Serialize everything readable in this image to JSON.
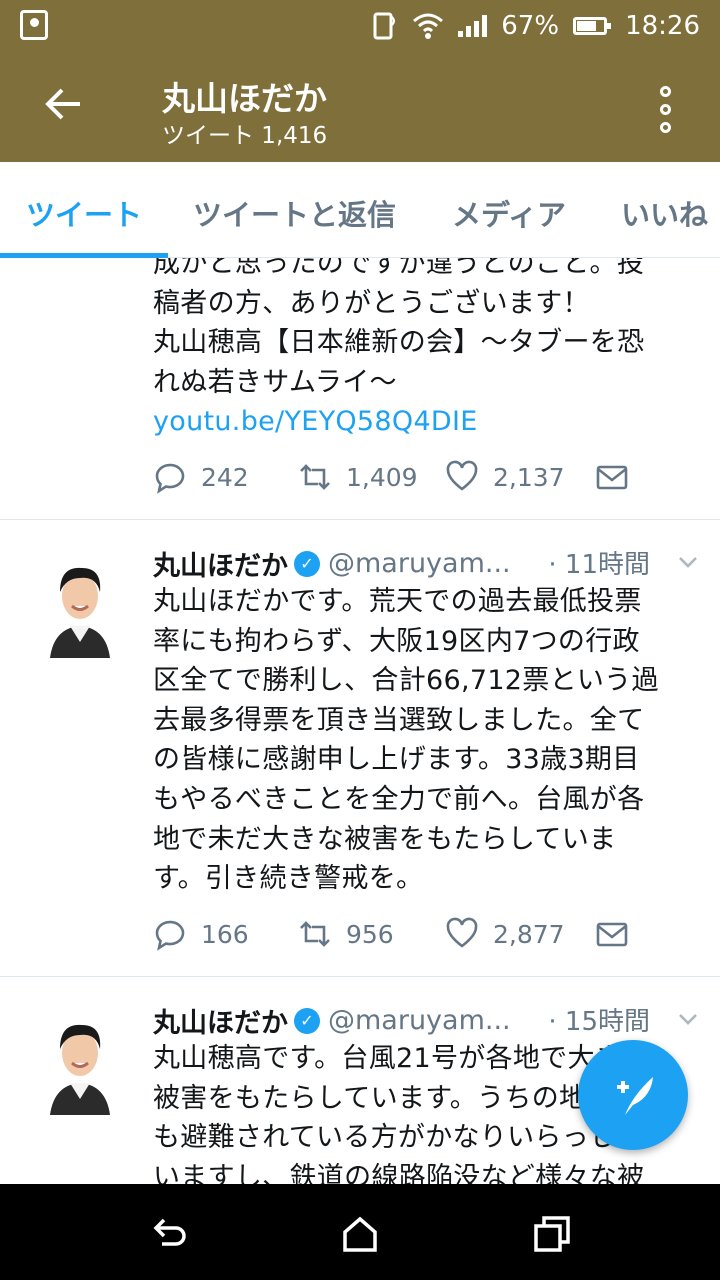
{
  "status_bar": {
    "battery": "67%",
    "time": "18:26",
    "battery_level": 0.67
  },
  "header": {
    "back_icon": "arrow-left-icon",
    "title": "丸山ほだか",
    "subtitle": "ツイート 1,416",
    "more_icon": "more-vertical-icon"
  },
  "tabs": [
    {
      "label": "ツイート",
      "active": true
    },
    {
      "label": "ツイートと返信",
      "active": false
    },
    {
      "label": "メディア",
      "active": false
    },
    {
      "label": "いいね",
      "active": false
    }
  ],
  "tweets": [
    {
      "lines": [
        "成かと思ったのですが違うとのこと。投",
        "稿者の方、ありがとうございます！",
        "丸山穂高【日本維新の会】～タブーを恐",
        "れぬ若きサムライ～"
      ],
      "link": "youtu.be/YEYQ58Q4DIE",
      "replies": "242",
      "retweets": "1,409",
      "likes": "2,137"
    },
    {
      "name": "丸山ほだか",
      "handle": "@maruyam...",
      "time": "· 11時間",
      "lines": [
        "丸山ほだかです。荒天での過去最低投票",
        "率にも拘わらず、大阪19区内7つの行政",
        "区全てで勝利し、合計66,712票という過",
        "去最多得票を頂き当選致しました。全て",
        "の皆様に感謝申し上げます。33歳3期目",
        "もやるべきことを全力で前へ。台風が各",
        "地で未だ大きな被害をもたらしていま",
        "す。引き続き警戒を。"
      ],
      "replies": "166",
      "retweets": "956",
      "likes": "2,877"
    },
    {
      "name": "丸山ほだか",
      "handle": "@maruyam...",
      "time": "· 15時間",
      "lines": [
        "丸山穂高です。台風21号が各地で大きな",
        "被害をもたらしています。うちの地元で",
        "も避難されている方がかなりいらっしゃ",
        "いますし、鉄道の線路陥没など様々な被"
      ]
    }
  ],
  "fab": {
    "icon": "compose-tweet-icon",
    "label": "+"
  },
  "nav": {
    "back_icon": "nav-back-icon",
    "home_icon": "nav-home-icon",
    "recents_icon": "nav-recents-icon"
  },
  "colors": {
    "header_bg": "#7f6f3b",
    "accent": "#1da1f2",
    "secondary_text": "#657786"
  }
}
